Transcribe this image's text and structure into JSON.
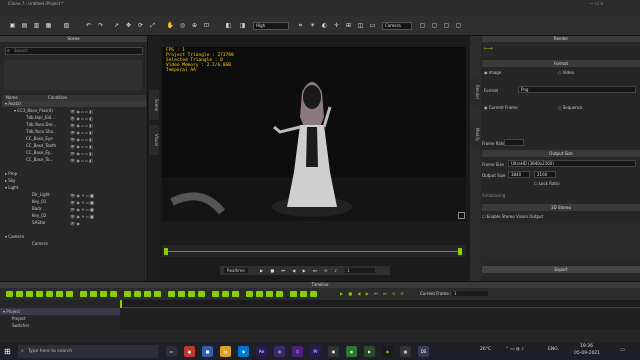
{
  "window": {
    "title": "iClone 7 - Untitled.iProject *"
  },
  "menu": [
    "File",
    "Edit",
    "Create",
    "Modify",
    "Animation",
    "Render",
    "View",
    "Window",
    "Plugins",
    "Script",
    "Help"
  ],
  "toolbar": {
    "quality": "High",
    "camera": "Camera"
  },
  "scene": {
    "title": "Scene",
    "search_placeholder": "Search",
    "col_name": "Name",
    "col_condition": "Condition",
    "rows": [
      "Avatar",
      "CC3_Base_Plus(4)",
      "Tdb.Hair_Eld...",
      "Tdb.Yoon.Dre...",
      "Tdb.Yoon.Sho...",
      "CC_Base_Eye",
      "CC_Base_Tooth",
      "CC_Base_Ey...",
      "CC_Base_To...",
      "Prop",
      "Sky",
      "Light",
      "Dir_Light",
      "Key_01",
      "Back",
      "Key_02",
      "SAStar",
      "Camera",
      "Camera"
    ]
  },
  "side_tabs": [
    "Scene",
    "Visual"
  ],
  "viewport": {
    "hud": [
      "FPS : 1",
      "Project Triangle : 273780",
      "Selected Triangle : 0",
      "Video Memory : 2.2/6.0GB",
      "Temporal AA"
    ],
    "realtime": "Realtime",
    "frame": "1"
  },
  "modify": {
    "title": "Render",
    "tabs": [
      "Render",
      "Modify"
    ],
    "format_header": "Format",
    "image": "Image",
    "video": "Video",
    "format_label": "Format",
    "format_value": "Png",
    "current_frame": "Current Frame",
    "sequence": "Sequence",
    "frame_rate": "Frame Rate",
    "output_size_header": "Output Size",
    "frame_size_label": "Frame Size",
    "frame_size_value": "UltraHD (3840x2160)",
    "output_size_label": "Output Size",
    "width": "3840",
    "height": "2160",
    "lock_ratio": "Lock Ratio",
    "antialias": "Antialiasing",
    "stereo_header": "3D Stereo",
    "enable_stereo": "Enable Stereo Vision Output",
    "export": "Export"
  },
  "timeline": {
    "title": "Timeline",
    "current_frame_label": "Current Frame :",
    "current_frame": "1",
    "tracks": [
      "Project",
      "Project",
      "Switcher"
    ]
  },
  "taskbar": {
    "search": "Type here to search",
    "temp": "26°C",
    "lang": "ENG",
    "time": "19:36",
    "date": "05-09-2021"
  },
  "colors": {
    "accent": "#8ad000",
    "hud": "#ffd400"
  }
}
